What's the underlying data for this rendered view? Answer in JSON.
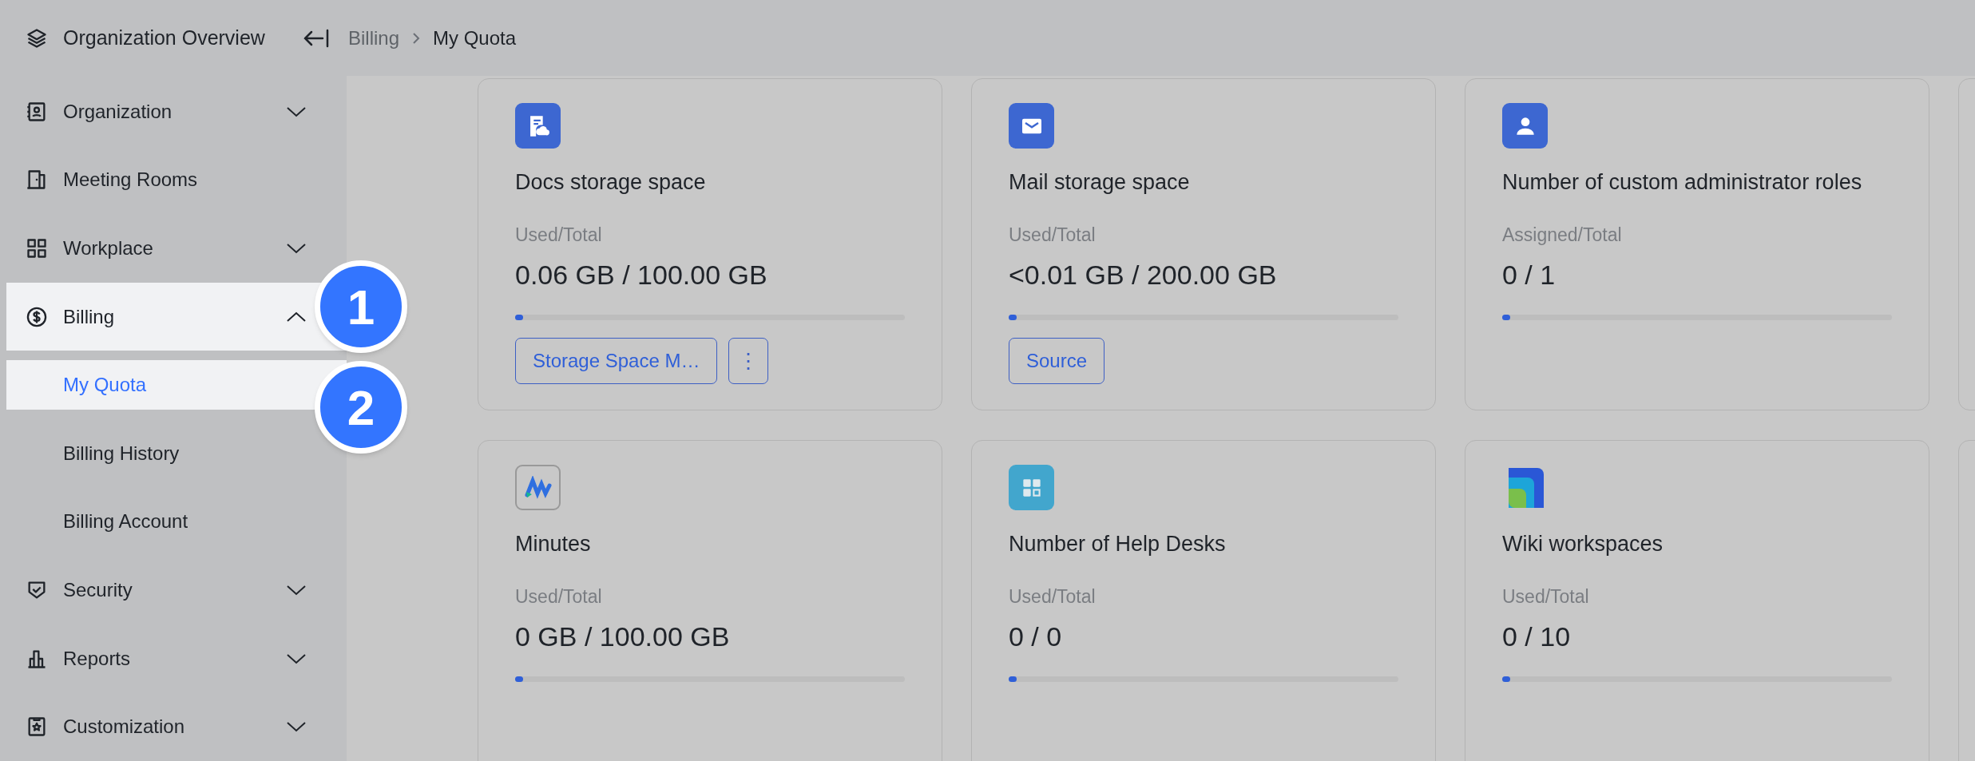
{
  "header": {
    "title": "Organization Overview",
    "breadcrumb": [
      "Billing",
      "My Quota"
    ]
  },
  "sidebar": {
    "items": [
      {
        "kind": "group",
        "label": "Organization",
        "expanded": false,
        "selected": false
      },
      {
        "kind": "item",
        "label": "Meeting Rooms",
        "selected": false
      },
      {
        "kind": "group",
        "label": "Workplace",
        "expanded": false,
        "selected": false
      },
      {
        "kind": "group",
        "label": "Billing",
        "expanded": true,
        "selected": true,
        "children": [
          {
            "label": "My Quota",
            "selected": true
          },
          {
            "label": "Billing History",
            "selected": false
          },
          {
            "label": "Billing Account",
            "selected": false
          }
        ]
      },
      {
        "kind": "group",
        "label": "Security",
        "expanded": false,
        "selected": false
      },
      {
        "kind": "group",
        "label": "Reports",
        "expanded": false,
        "selected": false
      },
      {
        "kind": "group",
        "label": "Customization",
        "expanded": false,
        "selected": false
      }
    ]
  },
  "annotations": [
    {
      "label": "1"
    },
    {
      "label": "2"
    }
  ],
  "cards": [
    {
      "title": "Docs storage space",
      "metric": "Used/Total",
      "value": "0.06 GB / 100.00 GB",
      "level": 0.02,
      "actions": [
        {
          "kind": "text",
          "label": "Storage Space M…"
        },
        {
          "kind": "more",
          "label": "⋮"
        }
      ]
    },
    {
      "title": "Mail storage space",
      "metric": "Used/Total",
      "value": "<0.01 GB / 200.00 GB",
      "level": 0.02,
      "actions": [
        {
          "kind": "text",
          "label": "Source"
        }
      ]
    },
    {
      "title": "Number of custom administrator roles",
      "metric": "Assigned/Total",
      "value": "0 / 1",
      "level": 0.02
    },
    {
      "title": "Minutes",
      "metric": "Used/Total",
      "value": "0 GB / 100.00 GB",
      "level": 0.02
    },
    {
      "title": "Number of Help Desks",
      "metric": "Used/Total",
      "value": "0 / 0",
      "level": 0.02
    },
    {
      "title": "Wiki workspaces",
      "metric": "Used/Total",
      "value": "0 / 10",
      "level": 0.02
    }
  ]
}
